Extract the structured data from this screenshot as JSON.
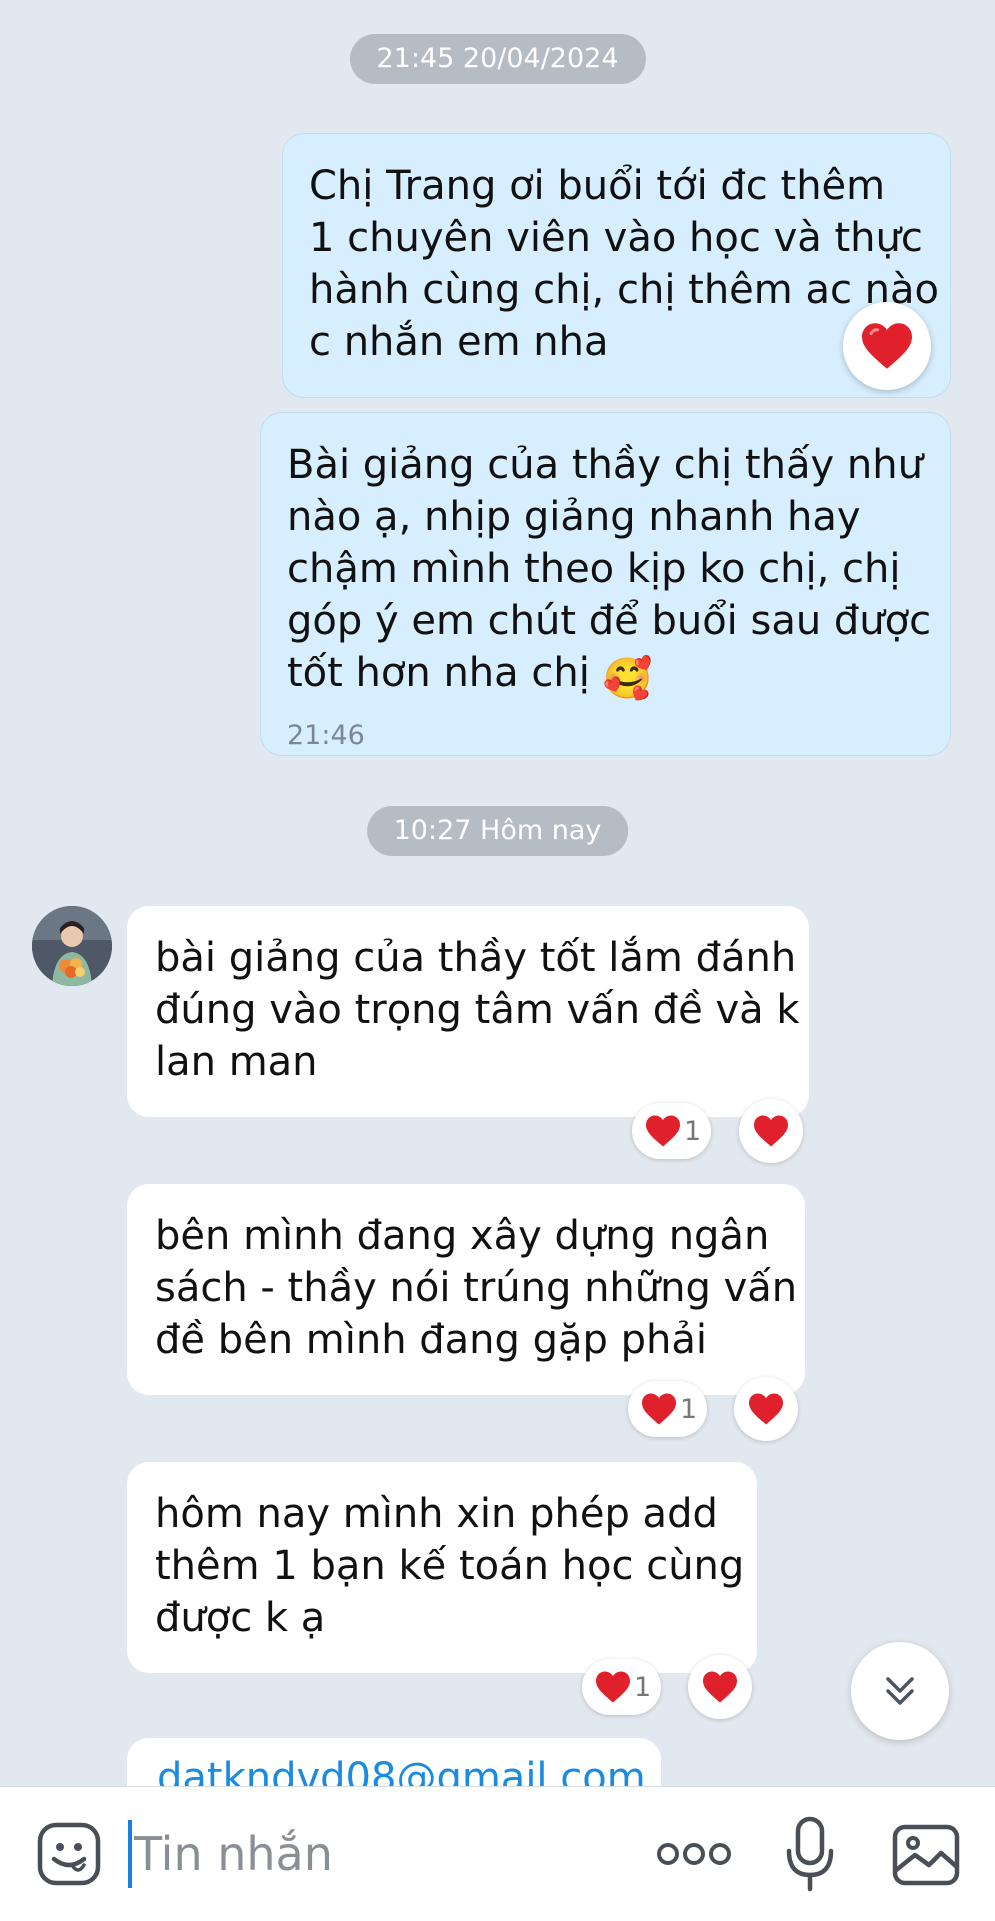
{
  "conversation": {
    "separators": [
      "21:45 20/04/2024",
      "10:27 Hôm nay"
    ],
    "outgoing": [
      {
        "lines": [
          "Chị Trang ơi buổi tới đc thêm",
          "1 chuyên viên vào học và thực",
          "hành cùng chị, chị thêm ac nào",
          "c nhắn em nha"
        ],
        "reaction": "heart-icon"
      },
      {
        "lines": [
          "Bài giảng của thầy chị thấy như",
          "nào ạ, nhịp giảng nhanh hay",
          "chậm mình theo kịp ko chị, chị",
          "góp ý em chút để buổi sau được",
          "tốt hơn nha chị"
        ],
        "emoji": "🥰",
        "time": "21:46"
      }
    ],
    "incoming": [
      {
        "lines": [
          "bài giảng của thầy tốt lắm đánh",
          "đúng vào trọng tâm vấn đề và k",
          "lan man"
        ],
        "reaction_count": "1"
      },
      {
        "lines": [
          "bên mình đang xây dựng ngân",
          "sách - thầy nói trúng những vấn",
          "đề bên mình đang gặp phải"
        ],
        "reaction_count": "1"
      },
      {
        "lines": [
          "hôm nay mình xin phép add",
          "thêm 1 bạn kế toán học cùng",
          "được k ạ"
        ],
        "reaction_count": "1"
      }
    ],
    "partial_message": "datkndvd08@gmail.com"
  },
  "input_bar": {
    "placeholder": "Tin nhắn",
    "icons": [
      "sticker-icon",
      "more-icon",
      "microphone-icon",
      "image-icon"
    ]
  },
  "colors": {
    "background": "#e2e8ef",
    "outgoing_bubble": "#d7eefe",
    "incoming_bubble": "#ffffff",
    "heart": "#e0202b",
    "accent": "#1a7fe3"
  }
}
